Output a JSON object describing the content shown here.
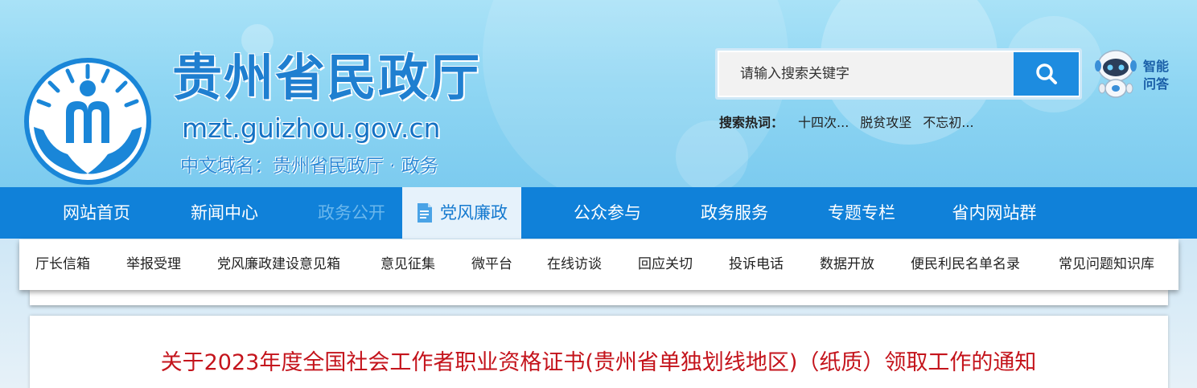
{
  "header": {
    "site_title": "贵州省民政厅",
    "domain": "mzt.guizhou.gov.cn",
    "cn_domain": "中文域名：贵州省民政厅 · 政务",
    "emblem_icon": "civil-affairs-emblem-icon",
    "colors": {
      "title_blue": "#1f7fd0",
      "header_bg": "#8fd6f3"
    }
  },
  "search": {
    "placeholder": "请输入搜索关键字",
    "button_icon": "search-icon",
    "hot_label": "搜索热词：",
    "hot_words": [
      "十四次...",
      "脱贫攻坚",
      "不忘初..."
    ]
  },
  "assistant": {
    "icon": "robot-icon",
    "label_line1": "智能",
    "label_line2": "问答"
  },
  "nav": {
    "items": [
      {
        "label": "网站首页"
      },
      {
        "label": "新闻中心"
      },
      {
        "label": "政务公开"
      },
      {
        "label": "党风廉政",
        "icon": "document-icon"
      },
      {
        "label": "公众参与"
      },
      {
        "label": "政务服务"
      },
      {
        "label": "专题专栏"
      },
      {
        "label": "省内网站群"
      }
    ],
    "active": "党风廉政",
    "colors": {
      "bar": "#1081d9",
      "active_bg": "#e6f2fb",
      "active_text": "#1479cf"
    }
  },
  "subnav": {
    "items": [
      {
        "label": "厅长信箱"
      },
      {
        "label": "举报受理"
      },
      {
        "label": "党风廉政建设意见箱"
      },
      {
        "label": "意见征集"
      },
      {
        "label": "微平台"
      },
      {
        "label": "在线访谈"
      },
      {
        "label": "回应关切"
      },
      {
        "label": "投诉电话"
      },
      {
        "label": "数据开放"
      },
      {
        "label": "便民利民名单名录"
      },
      {
        "label": "常见问题知识库"
      }
    ]
  },
  "article": {
    "title": "关于2023年度全国社会工作者职业资格证书(贵州省单独划线地区)（纸质）领取工作的通知",
    "title_color": "#c4141c"
  }
}
